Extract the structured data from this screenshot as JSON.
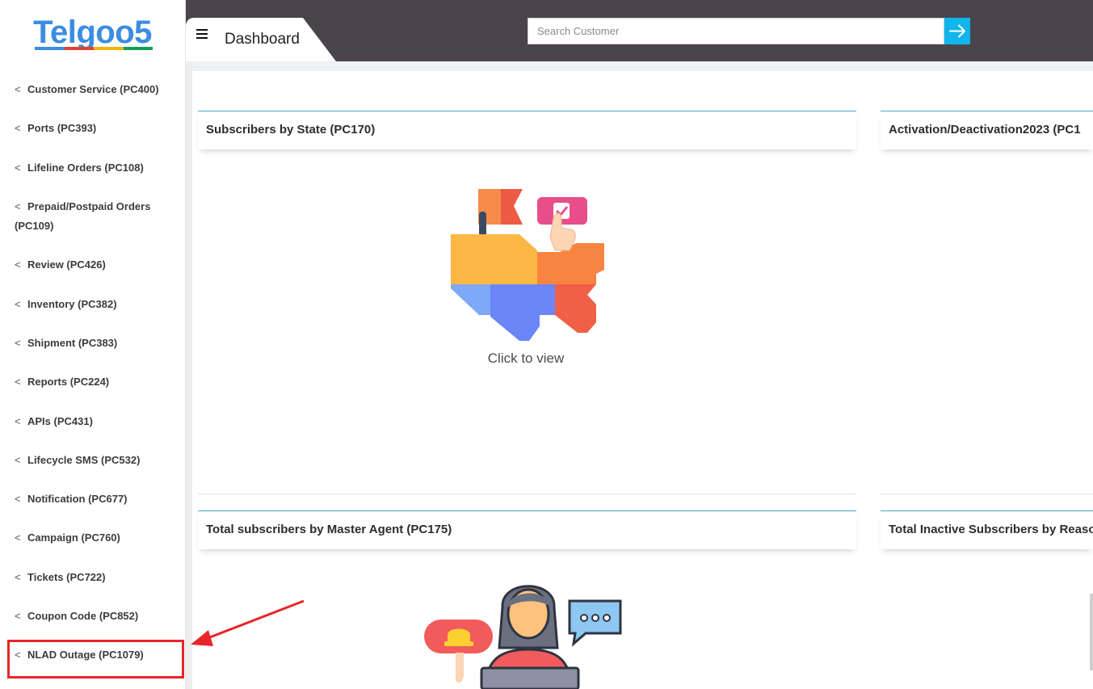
{
  "app": {
    "logo_text": "Telgoo5",
    "logo_bar_colors": [
      "#3b8de2",
      "#e34133",
      "#f4b400",
      "#0f9d58"
    ]
  },
  "sidebar": {
    "items": [
      {
        "label": "Customer Service (PC400)"
      },
      {
        "label": "Ports (PC393)"
      },
      {
        "label": "Lifeline Orders (PC108)"
      },
      {
        "label": "Prepaid/Postpaid Orders (PC109)"
      },
      {
        "label": "Review (PC426)"
      },
      {
        "label": "Inventory (PC382)"
      },
      {
        "label": "Shipment (PC383)"
      },
      {
        "label": "Reports (PC224)"
      },
      {
        "label": "APIs (PC431)"
      },
      {
        "label": "Lifecycle SMS (PC532)"
      },
      {
        "label": "Notification (PC677)"
      },
      {
        "label": "Campaign (PC760)"
      },
      {
        "label": "Tickets (PC722)"
      },
      {
        "label": "Coupon Code (PC852)"
      },
      {
        "label": "NLAD Outage (PC1079)"
      }
    ],
    "chevron": "<"
  },
  "header": {
    "title": "Dashboard",
    "search": {
      "placeholder": "Search Customer",
      "value": ""
    }
  },
  "cards": {
    "subscribers_by_state": {
      "title": "Subscribers by State (PC170)",
      "action": "Click to view"
    },
    "activation": {
      "title": "Activation/Deactivation2023 (PC1"
    },
    "master_agent": {
      "title": "Total subscribers by Master Agent (PC175)"
    },
    "inactive": {
      "title": "Total Inactive Subscribers by Reaso"
    }
  },
  "colors": {
    "topbar": "#4a454b",
    "accent": "#12b4ec",
    "card_border": "#46a9c7",
    "annotation_red": "#e8262a"
  }
}
